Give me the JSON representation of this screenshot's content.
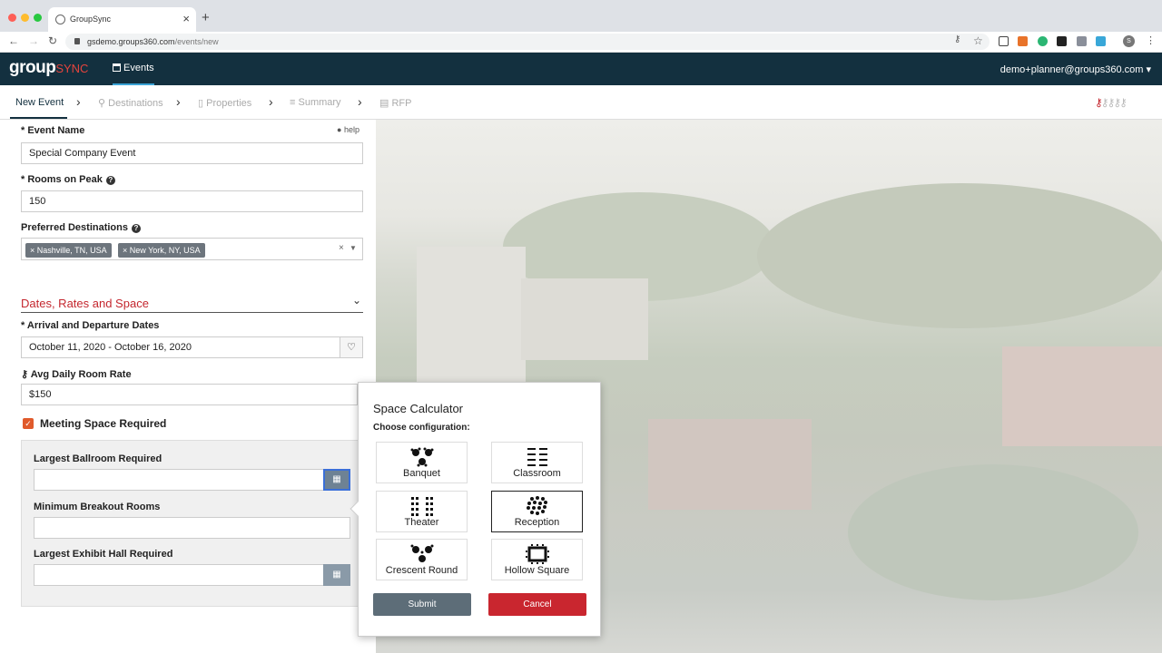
{
  "browser": {
    "tab_title": "GroupSync",
    "url_host": "gsdemo.groups360.com",
    "url_path": "/events/new",
    "avatar_letter": "S"
  },
  "header": {
    "logo_main": "group",
    "logo_sync": "SYNC",
    "nav_events": "Events",
    "user": "demo+planner@groups360.com"
  },
  "wizard": {
    "steps": [
      "New Event",
      "Destinations",
      "Properties",
      "Summary",
      "RFP"
    ]
  },
  "form": {
    "event_name_label": "* Event Name",
    "help_label": "help",
    "event_name_value": "Special Company Event",
    "rooms_label": "* Rooms on Peak",
    "rooms_value": "150",
    "destinations_label": "Preferred Destinations",
    "destinations": [
      "Nashville, TN, USA",
      "New York, NY, USA"
    ],
    "section_title": "Dates, Rates and Space",
    "dates_label": "* Arrival and Departure Dates",
    "dates_value": "October 11, 2020 - October 16, 2020",
    "rate_label": "Avg Daily Room Rate",
    "rate_value": "$150",
    "meeting_label": "Meeting Space Required",
    "ballroom_label": "Largest Ballroom Required",
    "breakout_label": "Minimum Breakout Rooms",
    "exhibit_label": "Largest Exhibit Hall Required"
  },
  "modal": {
    "title": "Space Calculator",
    "subtitle": "Choose configuration:",
    "options": [
      "Banquet",
      "Classroom",
      "Theater",
      "Reception",
      "Crescent Round",
      "Hollow Square"
    ],
    "selected": "Reception",
    "submit": "Submit",
    "cancel": "Cancel"
  },
  "colors": {
    "header_bg": "#13303f",
    "accent_red": "#c4262e",
    "submit_bg": "#5d6d78",
    "checkbox": "#e05a2b"
  }
}
